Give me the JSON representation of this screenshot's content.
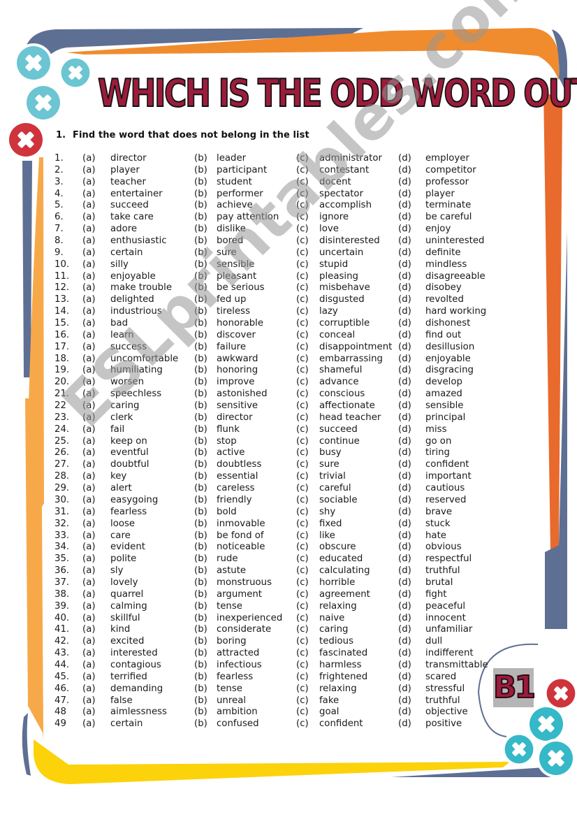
{
  "worksheet": {
    "title": "WHICH IS THE ODD WORD OUT?",
    "instruction": {
      "number": "1.",
      "text": "Find the word that does not belong in the list"
    },
    "option_labels": {
      "a": "(a)",
      "b": "(b)",
      "c": "(c)",
      "d": "(d)"
    },
    "items": [
      {
        "num": "1.",
        "a": "director",
        "b": "leader",
        "c": "administrator",
        "d": "employer"
      },
      {
        "num": "2.",
        "a": "player",
        "b": "participant",
        "c": "contestant",
        "d": "competitor"
      },
      {
        "num": "3.",
        "a": "teacher",
        "b": "student",
        "c": "docent",
        "d": "professor"
      },
      {
        "num": "4.",
        "a": "entertainer",
        "b": "performer",
        "c": "spectator",
        "d": "player"
      },
      {
        "num": "5.",
        "a": "succeed",
        "b": "achieve",
        "c": "accomplish",
        "d": "terminate"
      },
      {
        "num": "6.",
        "a": "take care",
        "b": "pay attention",
        "c": "ignore",
        "d": "be careful"
      },
      {
        "num": "7.",
        "a": "adore",
        "b": "dislike",
        "c": "love",
        "d": "enjoy"
      },
      {
        "num": "8.",
        "a": "enthusiastic",
        "b": "bored",
        "c": "disinterested",
        "d": "uninterested"
      },
      {
        "num": "9.",
        "a": "certain",
        "b": "sure",
        "c": "uncertain",
        "d": "definite"
      },
      {
        "num": "10.",
        "a": "silly",
        "b": "sensible",
        "c": "stupid",
        "d": "mindless"
      },
      {
        "num": "11.",
        "a": "enjoyable",
        "b": "pleasant",
        "c": "pleasing",
        "d": "disagreeable"
      },
      {
        "num": "12.",
        "a": "make trouble",
        "b": "be serious",
        "c": "misbehave",
        "d": "disobey"
      },
      {
        "num": "13.",
        "a": "delighted",
        "b": "fed up",
        "c": "disgusted",
        "d": "revolted"
      },
      {
        "num": "14.",
        "a": "industrious",
        "b": "tireless",
        "c": "lazy",
        "d": "hard working"
      },
      {
        "num": "15.",
        "a": "bad",
        "b": "honorable",
        "c": "corruptible",
        "d": "dishonest"
      },
      {
        "num": "16.",
        "a": "learn",
        "b": "discover",
        "c": "conceal",
        "d": "find out"
      },
      {
        "num": "17.",
        "a": "success",
        "b": "failure",
        "c": "disappointment",
        "d": "desillusion"
      },
      {
        "num": "18.",
        "a": "uncomfortable",
        "b": "awkward",
        "c": "embarrassing",
        "d": "enjoyable"
      },
      {
        "num": "19.",
        "a": "humiliating",
        "b": "honoring",
        "c": "shameful",
        "d": "disgracing"
      },
      {
        "num": "20.",
        "a": "worsen",
        "b": "improve",
        "c": "advance",
        "d": "develop"
      },
      {
        "num": "21.",
        "a": "speechless",
        "b": "astonished",
        "c": "conscious",
        "d": "amazed"
      },
      {
        "num": "22",
        "a": "caring",
        "b": "sensitive",
        "c": "affectionate",
        "d": "sensible"
      },
      {
        "num": "23.",
        "a": "clerk",
        "b": "director",
        "c": "head teacher",
        "d": "principal"
      },
      {
        "num": "24.",
        "a": "fail",
        "b": "flunk",
        "c": "succeed",
        "d": "miss"
      },
      {
        "num": "25.",
        "a": "keep on",
        "b": "stop",
        "c": "continue",
        "d": "go on"
      },
      {
        "num": "26.",
        "a": "eventful",
        "b": "active",
        "c": "busy",
        "d": "tiring"
      },
      {
        "num": "27.",
        "a": "doubtful",
        "b": "doubtless",
        "c": "sure",
        "d": "confident"
      },
      {
        "num": "28.",
        "a": "key",
        "b": "essential",
        "c": "trivial",
        "d": "important"
      },
      {
        "num": "29.",
        "a": "alert",
        "b": "careless",
        "c": "careful",
        "d": "cautious"
      },
      {
        "num": "30.",
        "a": "easygoing",
        "b": "friendly",
        "c": "sociable",
        "d": "reserved"
      },
      {
        "num": "31.",
        "a": "fearless",
        "b": "bold",
        "c": "shy",
        "d": "brave"
      },
      {
        "num": "32.",
        "a": "loose",
        "b": "inmovable",
        "c": "fixed",
        "d": "stuck"
      },
      {
        "num": "33.",
        "a": "care",
        "b": "be fond of",
        "c": "like",
        "d": "hate"
      },
      {
        "num": "34.",
        "a": "evident",
        "b": "noticeable",
        "c": "obscure",
        "d": "obvious"
      },
      {
        "num": "35.",
        "a": "polite",
        "b": "rude",
        "c": "educated",
        "d": "respectful"
      },
      {
        "num": "36.",
        "a": "sly",
        "b": "astute",
        "c": "calculating",
        "d": "truthful"
      },
      {
        "num": "37.",
        "a": "lovely",
        "b": "monstruous",
        "c": "horrible",
        "d": "brutal"
      },
      {
        "num": "38.",
        "a": "quarrel",
        "b": "argument",
        "c": "agreement",
        "d": "fight"
      },
      {
        "num": "39.",
        "a": "calming",
        "b": "tense",
        "c": "relaxing",
        "d": "peaceful"
      },
      {
        "num": "40.",
        "a": "skillful",
        "b": "inexperienced",
        "c": "naive",
        "d": "innocent"
      },
      {
        "num": "41.",
        "a": "kind",
        "b": "considerate",
        "c": "caring",
        "d": "unfamiliar"
      },
      {
        "num": "42.",
        "a": "excited",
        "b": "boring",
        "c": "tedious",
        "d": "dull"
      },
      {
        "num": "43.",
        "a": "interested",
        "b": "attracted",
        "c": "fascinated",
        "d": "indifferent"
      },
      {
        "num": "44.",
        "a": "contagious",
        "b": "infectious",
        "c": "harmless",
        "d": "transmittable"
      },
      {
        "num": "45.",
        "a": "terrified",
        "b": "fearless",
        "c": "frightened",
        "d": "scared"
      },
      {
        "num": "46.",
        "a": "demanding",
        "b": "tense",
        "c": "relaxing",
        "d": "stressful"
      },
      {
        "num": "47.",
        "a": "false",
        "b": "unreal",
        "c": "fake",
        "d": "truthful"
      },
      {
        "num": "48",
        "a": "aimlessness",
        "b": "ambition",
        "c": "goal",
        "d": "objective"
      },
      {
        "num": "49",
        "a": "certain",
        "b": "confused",
        "c": "confident",
        "d": "positive"
      }
    ],
    "level_badge": "B1",
    "watermark": "ESLprintables.com"
  },
  "decorations": {
    "icons": [
      "close-x-icon"
    ],
    "colors": {
      "navy": "#5e6f94",
      "orange": "#f08c2e",
      "orange_dark": "#e86a2c",
      "light_orange": "#f7a94a",
      "yellow": "#fcd20a",
      "teal": "#5cc3cf",
      "red": "#cf333c",
      "title_fill": "#9c1c3c"
    }
  }
}
